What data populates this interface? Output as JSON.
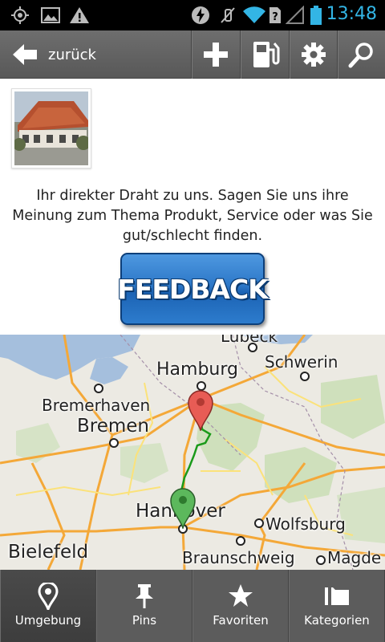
{
  "status_bar": {
    "time": "13:48",
    "icons": [
      "gps-icon",
      "image-icon",
      "warning-icon",
      "flash-icon",
      "mute-icon",
      "wifi-icon",
      "no-sim-icon",
      "signal-icon",
      "battery-icon"
    ],
    "accent_color": "#33b5e5"
  },
  "action_bar": {
    "back_label": "zurück",
    "buttons": [
      "add-icon",
      "fuel-icon",
      "gear-icon",
      "search-icon"
    ]
  },
  "content": {
    "message": "Ihr direkter Draht zu uns. Sagen Sie uns ihre Meinung zum Thema Produkt, Service oder was Sie gut/schlecht finden.",
    "feedback_label": "FEEDBACK",
    "feedback_color": "#2d78c8"
  },
  "map": {
    "labels": {
      "luebeck": "Lübeck",
      "hamburg": "Hamburg",
      "schwerin": "Schwerin",
      "bremerhaven": "Bremerhaven",
      "bremen": "Bremen",
      "hannover": "Hannover",
      "wolfsburg": "Wolfsburg",
      "bielefeld": "Bielefeld",
      "braunschweig": "Braunschweig",
      "magdeburg": "Magde"
    },
    "route_color": "#1a9a1a",
    "start_pin_color": "#5cb85c",
    "end_pin_color": "#e85c55"
  },
  "tabs": [
    {
      "label": "Umgebung",
      "icon": "location-pin-icon",
      "active": true
    },
    {
      "label": "Pins",
      "icon": "pushpin-icon",
      "active": false
    },
    {
      "label": "Favoriten",
      "icon": "star-icon",
      "active": false
    },
    {
      "label": "Kategorien",
      "icon": "folder-icon",
      "active": false
    }
  ]
}
